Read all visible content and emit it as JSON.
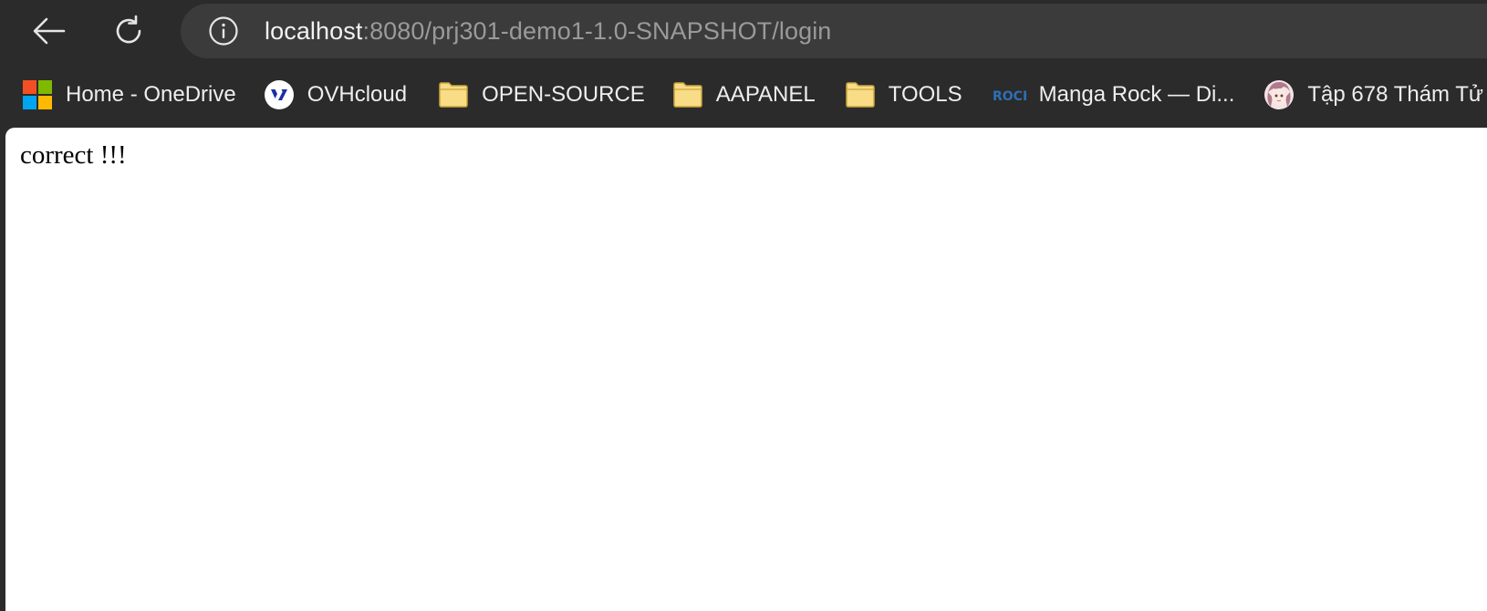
{
  "toolbar": {
    "back_icon": "arrow-left-icon",
    "reload_icon": "reload-icon",
    "info_icon": "info-icon"
  },
  "address_bar": {
    "host": "localhost",
    "rest": ":8080/prj301-demo1-1.0-SNAPSHOT/login"
  },
  "bookmarks": [
    {
      "label": "Home - OneDrive",
      "icon": "microsoft-logo-icon"
    },
    {
      "label": "OVHcloud",
      "icon": "ovhcloud-logo-icon"
    },
    {
      "label": "OPEN-SOURCE",
      "icon": "folder-icon"
    },
    {
      "label": "AAPANEL",
      "icon": "folder-icon"
    },
    {
      "label": "TOOLS",
      "icon": "folder-icon"
    },
    {
      "label": "Manga Rock — Di...",
      "icon": "manga-rock-logo-icon",
      "icon_text": "ROCK"
    },
    {
      "label": "Tập 678 Thám Tử",
      "icon": "anime-avatar-icon"
    }
  ],
  "page": {
    "message": "correct !!!"
  },
  "colors": {
    "chrome_bg": "#2b2b2b",
    "address_bg": "#3b3b3b",
    "folder_fill": "#f8dc86",
    "folder_stroke": "#c9a63c",
    "ovh_blue": "#1b2fa5",
    "rock_blue": "#2d6fb5"
  }
}
